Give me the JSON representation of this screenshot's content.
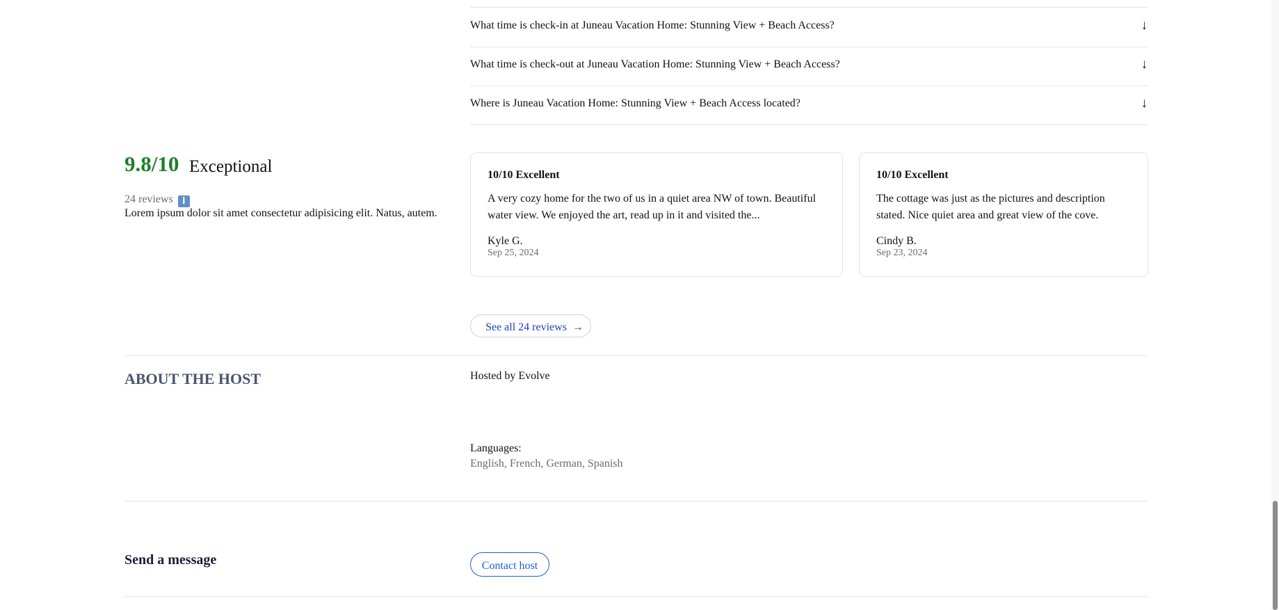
{
  "faq": {
    "items": [
      {
        "question": "What time is check-in at Juneau Vacation Home: Stunning View + Beach Access?",
        "toggle_icon": "↓"
      },
      {
        "question": "What time is check-out at Juneau Vacation Home: Stunning View + Beach Access?",
        "toggle_icon": "↓"
      },
      {
        "question": "Where is Juneau Vacation Home: Stunning View + Beach Access located?",
        "toggle_icon": "↓"
      }
    ]
  },
  "rating": {
    "score": "9.8/10",
    "label": "Exceptional",
    "review_count": "24 reviews",
    "info_icon": "i",
    "summary": "Lorem ipsum dolor sit amet consectetur adipisicing elit. Natus, autem.",
    "score_color": "#1e7e2a"
  },
  "reviews": [
    {
      "title": "10/10 Excellent",
      "body": "A very cozy home for the two of us in a quiet area NW of town. Beautiful water view. We enjoyed the art, read up in it and visited the...",
      "author": "Kyle G.",
      "date": "Sep 25, 2024"
    },
    {
      "title": "10/10 Excellent",
      "body": "The cottage was just as the pictures and description stated. Nice quiet area and great view of the cove.",
      "author": "Cindy B.",
      "date": "Sep 23, 2024"
    }
  ],
  "see_all": {
    "label": "See all 24 reviews",
    "arrow": "→"
  },
  "host": {
    "heading": "ABOUT THE HOST",
    "hosted_by": "Hosted by Evolve",
    "languages_label": "Languages:",
    "languages": "English, French, German, Spanish"
  },
  "message": {
    "heading": "Send a message",
    "contact_label": "Contact host"
  },
  "colors": {
    "link": "#1a3cc2",
    "button_blue": "#1a5fd0",
    "heading_slate": "#4a5470"
  }
}
